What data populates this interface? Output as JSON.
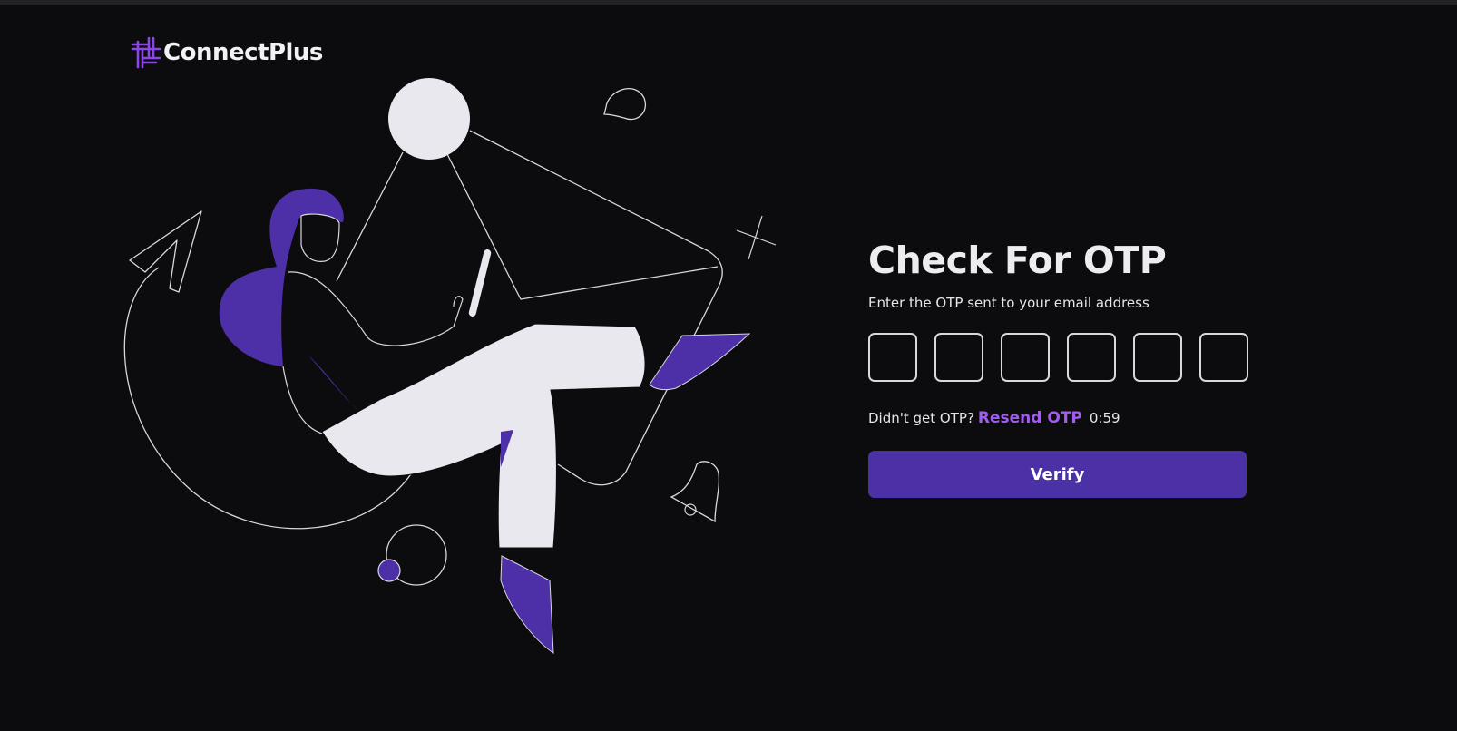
{
  "brand": {
    "name": "ConnectPlus",
    "logo_icon": "connectplus-logo-icon",
    "accent": "#8b46e8"
  },
  "otp": {
    "title": "Check For OTP",
    "subtitle": "Enter the OTP sent to your email address",
    "digits": [
      "",
      "",
      "",
      "",
      "",
      ""
    ],
    "resend_prompt": "Didn't get OTP?",
    "resend_label": "Resend OTP",
    "timer": "0:59",
    "verify_label": "Verify"
  },
  "colors": {
    "background": "#0c0c0e",
    "primary": "#4c30a6",
    "link": "#a25df0",
    "illustration_fill": "#e9e8ef",
    "illustration_accent": "#4d30a8"
  }
}
